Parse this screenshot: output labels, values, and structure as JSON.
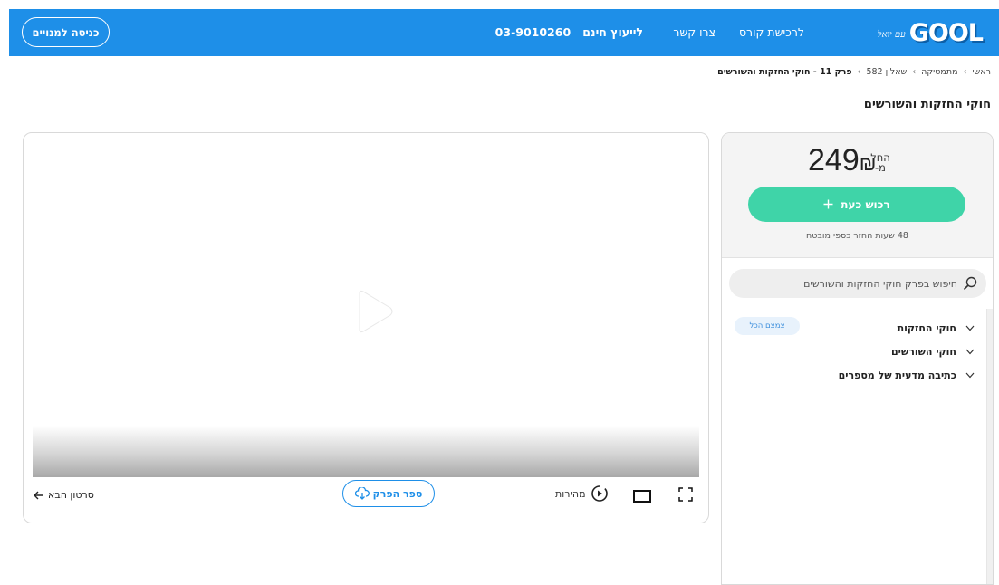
{
  "header": {
    "logo_tag": "עם יואל",
    "logo_text": "GOOL",
    "nav": {
      "buy_course": "לרכישת קורס",
      "contact": "צרו קשר",
      "free_consult": "לייעוץ חינם",
      "phone": "03-9010260"
    },
    "login_label": "כניסה למנויים"
  },
  "breadcrumb": {
    "items": [
      "ראשי",
      "מתמטיקה",
      "שאלון 582"
    ],
    "current": "פרק 11 - חוקי החזקות והשורשים",
    "separator": "›"
  },
  "page_title": "חוקי החזקות והשורשים",
  "player": {
    "next_video_label": "סרטון הבא",
    "book_label": "ספר הפרק",
    "speed_label": "מהירות"
  },
  "pricing": {
    "from_line1": "החל",
    "from_line2": "מ-",
    "price": "249",
    "currency": "₪",
    "register_label": "רכוש כעת",
    "guarantee": "48 שעות החזר כספי מובטח"
  },
  "search": {
    "placeholder": "חיפוש בפרק חוקי החזקות והשורשים"
  },
  "chapters": {
    "collapse_all_label": "צמצם הכל",
    "items": [
      {
        "label": "חוקי החזקות"
      },
      {
        "label": "חוקי השורשים"
      },
      {
        "label": "כתיבה מדעית של מספרים"
      }
    ]
  },
  "colors": {
    "brand_blue": "#1e8fe8",
    "register_green": "#3fd4a8",
    "collapse_blue": "#3d8fdc"
  }
}
